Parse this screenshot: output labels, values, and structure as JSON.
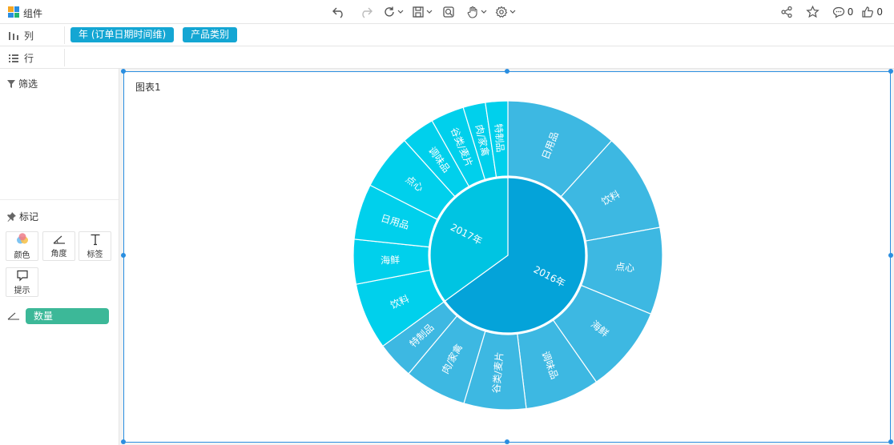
{
  "app": {
    "title": "组件"
  },
  "toolbar": {
    "buttons": [
      {
        "icon": "undo-icon"
      },
      {
        "icon": "redo-icon"
      },
      {
        "icon": "refresh-icon",
        "dropdown": true
      },
      {
        "icon": "save-icon",
        "dropdown": true
      },
      {
        "icon": "preview-icon"
      },
      {
        "icon": "hand-icon",
        "dropdown": true
      },
      {
        "icon": "settings-icon",
        "dropdown": true
      }
    ],
    "comments_count": "0",
    "likes_count": "0"
  },
  "shelves": {
    "columns": {
      "label": "列",
      "pills": [
        "年 (订单日期时间维)",
        "产品类别"
      ]
    },
    "rows": {
      "label": "行"
    }
  },
  "left_panel": {
    "filter_label": "筛选",
    "marks_label": "标记",
    "mark_buttons": [
      "颜色",
      "角度",
      "标签",
      "提示"
    ],
    "angle_field": "数量"
  },
  "chart": {
    "title": "图表1",
    "colors": {
      "y2016": "#04a3d9",
      "y2017": "#00c4e2",
      "outer2016": "#3db8e2",
      "outer2017": "#00d0ec"
    }
  },
  "chart_data": {
    "type": "sunburst",
    "levels": [
      "年",
      "产品类别"
    ],
    "hierarchy": [
      {
        "name": "2016年",
        "value": 65,
        "children": [
          {
            "name": "日用品",
            "value": 9
          },
          {
            "name": "饮料",
            "value": 8
          },
          {
            "name": "点心",
            "value": 7
          },
          {
            "name": "海鲜",
            "value": 7
          },
          {
            "name": "调味品",
            "value": 6
          },
          {
            "name": "谷类/麦片",
            "value": 5
          },
          {
            "name": "肉/家禽",
            "value": 5
          },
          {
            "name": "特制品",
            "value": 3
          }
        ]
      },
      {
        "name": "2017年",
        "value": 35,
        "children": [
          {
            "name": "饮料",
            "value": 6
          },
          {
            "name": "海鲜",
            "value": 4
          },
          {
            "name": "日用品",
            "value": 5
          },
          {
            "name": "点心",
            "value": 5
          },
          {
            "name": "调味品",
            "value": 3
          },
          {
            "name": "谷类/麦片",
            "value": 3
          },
          {
            "name": "肉/家禽",
            "value": 2
          },
          {
            "name": "特制品",
            "value": 2
          }
        ]
      }
    ]
  }
}
